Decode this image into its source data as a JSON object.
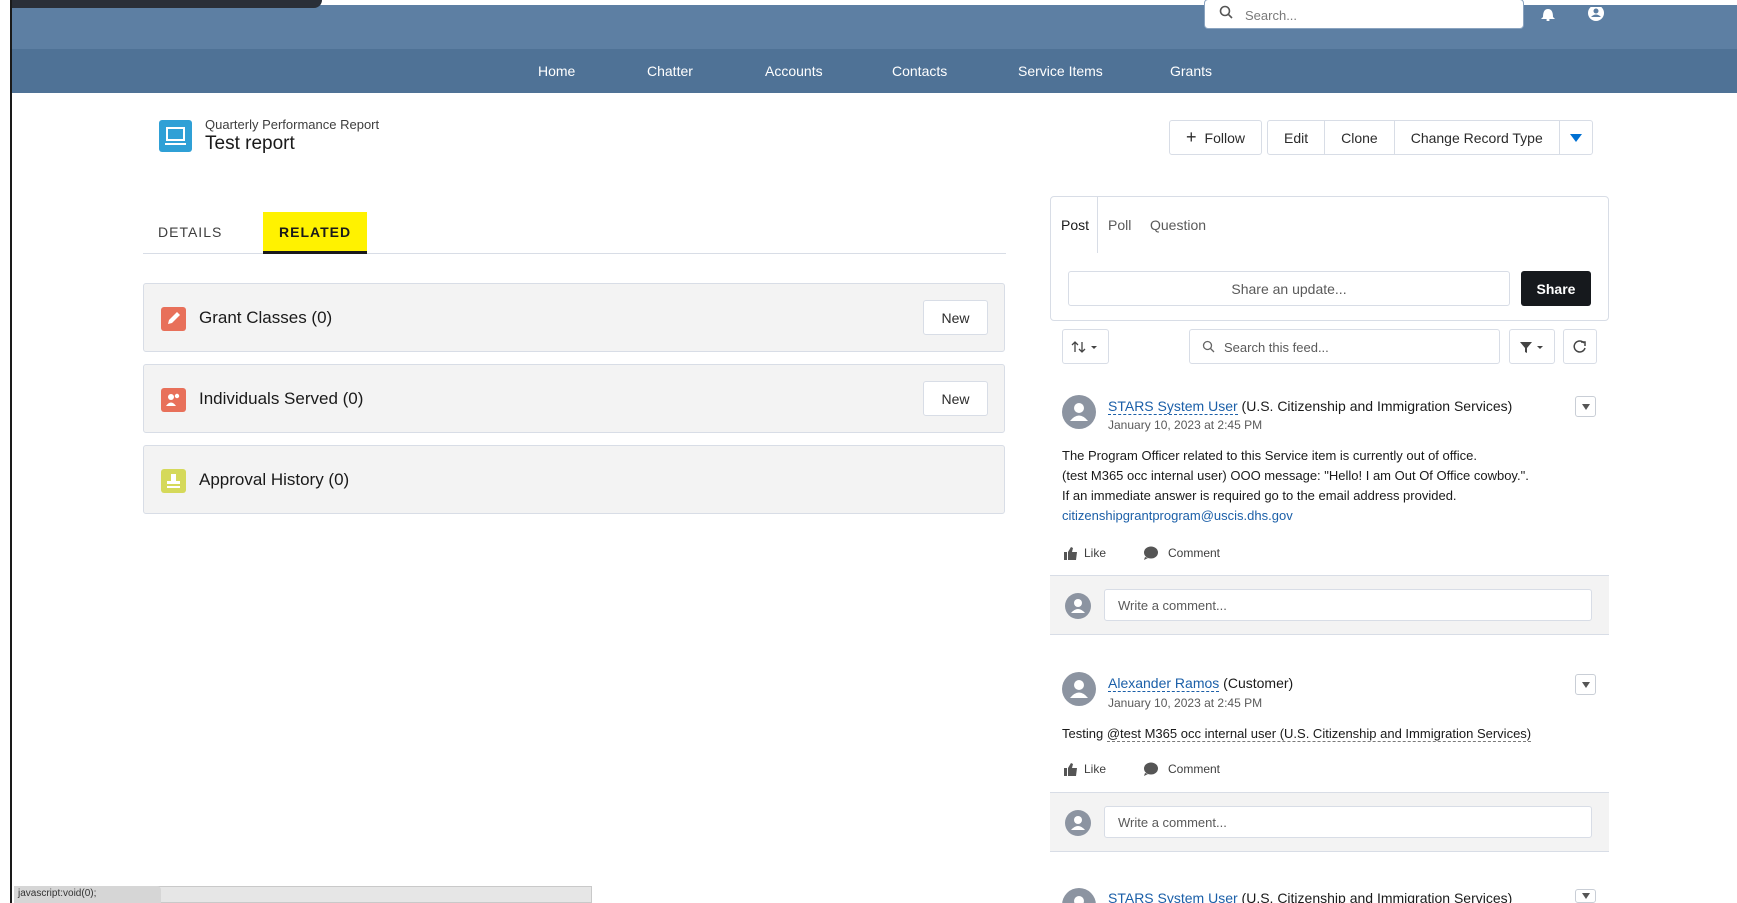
{
  "header": {
    "search_placeholder": "Search...",
    "bell_icon": "bell-icon",
    "avatar_icon": "user-avatar-icon"
  },
  "nav": {
    "items": [
      "Home",
      "Chatter",
      "Accounts",
      "Contacts",
      "Service Items",
      "Grants"
    ]
  },
  "record": {
    "type": "Quarterly Performance Report",
    "title": "Test report",
    "icon": "report-icon",
    "actions": {
      "follow": "Follow",
      "edit": "Edit",
      "clone": "Clone",
      "change_record_type": "Change Record Type"
    }
  },
  "tabs": {
    "details": "DETAILS",
    "related": "RELATED"
  },
  "related_lists": [
    {
      "title": "Grant Classes (0)",
      "button": "New",
      "icon": "pencil-icon",
      "color": "#e8705a"
    },
    {
      "title": "Individuals Served (0)",
      "button": "New",
      "icon": "people-icon",
      "color": "#e8705a"
    },
    {
      "title": "Approval History (0)",
      "icon": "stamp-icon",
      "color": "#d5d95a"
    }
  ],
  "publisher": {
    "tabs": [
      "Post",
      "Poll",
      "Question"
    ],
    "placeholder": "Share an update...",
    "share": "Share"
  },
  "feed": {
    "search_placeholder": "Search this feed...",
    "posts": [
      {
        "author": "STARS System User",
        "org": "(U.S. Citizenship and Immigration Services)",
        "time": "January 10, 2023 at 2:45 PM",
        "lines": [
          "The Program Officer related to this Service item is currently out of office.",
          "(test M365 occ internal user) OOO message: \"Hello! I am Out Of Office cowboy.\".",
          "If an immediate answer is required go to the email address provided."
        ],
        "email": "citizenshipgrantprogram@uscis.dhs.gov",
        "like": "Like",
        "comment": "Comment",
        "comment_placeholder": "Write a comment..."
      },
      {
        "author": "Alexander Ramos",
        "org": "(Customer)",
        "time": "January 10, 2023 at 2:45 PM",
        "body_prefix": "Testing",
        "mention": "@test M365 occ internal user (U.S. Citizenship and Immigration Services)",
        "like": "Like",
        "comment": "Comment",
        "comment_placeholder": "Write a comment..."
      },
      {
        "author": "STARS System User",
        "org": "(U.S. Citizenship and Immigration Services)"
      }
    ]
  },
  "status_bar": {
    "url_tip": "javascript:void(0);"
  }
}
